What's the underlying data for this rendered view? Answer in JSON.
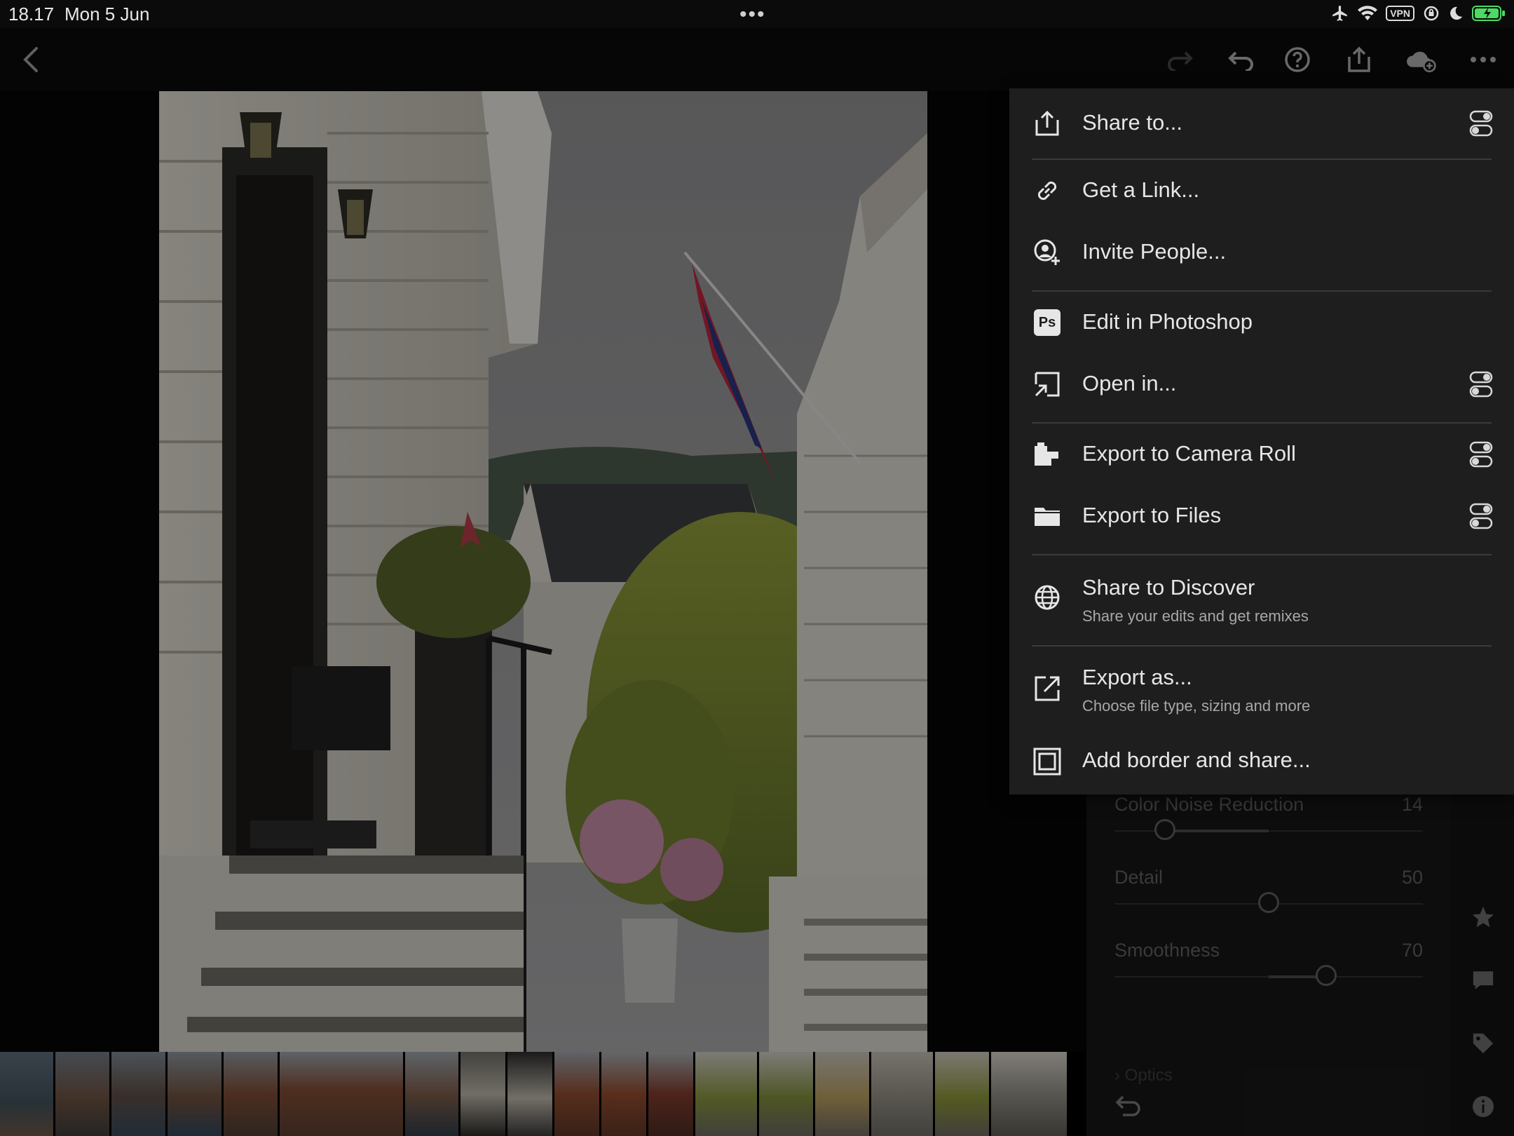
{
  "status_bar": {
    "time": "18.17",
    "date": "Mon 5 Jun",
    "vpn": "VPN"
  },
  "menu": {
    "items": [
      {
        "label": "Share to...",
        "icon": "share-icon",
        "toggle": true
      },
      {
        "label": "Get a Link...",
        "icon": "link-icon",
        "toggle": false
      },
      {
        "label": "Invite People...",
        "icon": "invite-person-icon",
        "toggle": false
      },
      {
        "label": "Edit in Photoshop",
        "icon": "photoshop-icon",
        "ps_badge": "Ps",
        "toggle": false
      },
      {
        "label": "Open in...",
        "icon": "open-in-icon",
        "toggle": true
      },
      {
        "label": "Export to Camera Roll",
        "icon": "camera-roll-icon",
        "toggle": true
      },
      {
        "label": "Export to Files",
        "icon": "folder-icon",
        "toggle": true
      },
      {
        "label": "Share to Discover",
        "sub": "Share your edits and get remixes",
        "icon": "globe-icon",
        "toggle": false
      },
      {
        "label": "Export as...",
        "sub": "Choose file type, sizing and more",
        "icon": "export-as-icon",
        "toggle": false
      },
      {
        "label": "Add border and share...",
        "icon": "border-icon",
        "toggle": false
      }
    ]
  },
  "detail_panel": {
    "sliders": [
      {
        "label": "Color Noise Reduction",
        "value": "14",
        "fraction": 0.14
      },
      {
        "label": "Detail",
        "value": "50",
        "fraction": 0.5
      },
      {
        "label": "Smoothness",
        "value": "70",
        "fraction": 0.7
      }
    ],
    "next_section": "Optics"
  },
  "colors": {
    "accent_battery": "#4cd964",
    "menu_bg": "#1e1e1e",
    "panel_bg": "#161616"
  }
}
